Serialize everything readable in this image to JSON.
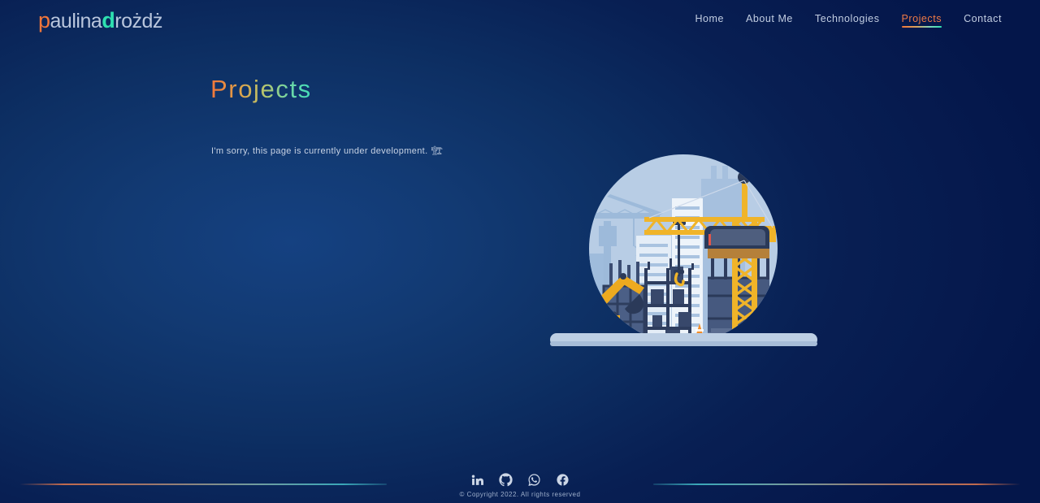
{
  "header": {
    "logo": {
      "part_p": "p",
      "part_mid": "aulina",
      "part_d": "d",
      "part_end": "rożdż",
      "full_text": "paulinadrożdż",
      "accent_p": "#f2763a",
      "accent_d": "#2ee0b0"
    },
    "nav": [
      {
        "label": "Home",
        "active": false
      },
      {
        "label": "About Me",
        "active": false
      },
      {
        "label": "Technologies",
        "active": false
      },
      {
        "label": "Projects",
        "active": true
      },
      {
        "label": "Contact",
        "active": false
      }
    ]
  },
  "main": {
    "title": "Projects",
    "subtitle": "I'm sorry, this page is currently under development.",
    "subtitle_emoji": "🏗",
    "illustration_name": "construction-site-illustration"
  },
  "footer": {
    "social": [
      {
        "name": "linkedin-icon",
        "label": "LinkedIn"
      },
      {
        "name": "github-icon",
        "label": "GitHub"
      },
      {
        "name": "whatsapp-icon",
        "label": "WhatsApp"
      },
      {
        "name": "facebook-icon",
        "label": "Facebook"
      }
    ],
    "copyright": "© Copyright 2022. All rights reserved"
  },
  "colors": {
    "background_dark": "#04164a",
    "background_light": "#154181",
    "accent_orange": "#f2763a",
    "accent_teal": "#2ee0b0",
    "text_primary": "#c3cfe3",
    "crane_yellow": "#f0b429",
    "building_blue": "#90b4dc"
  }
}
